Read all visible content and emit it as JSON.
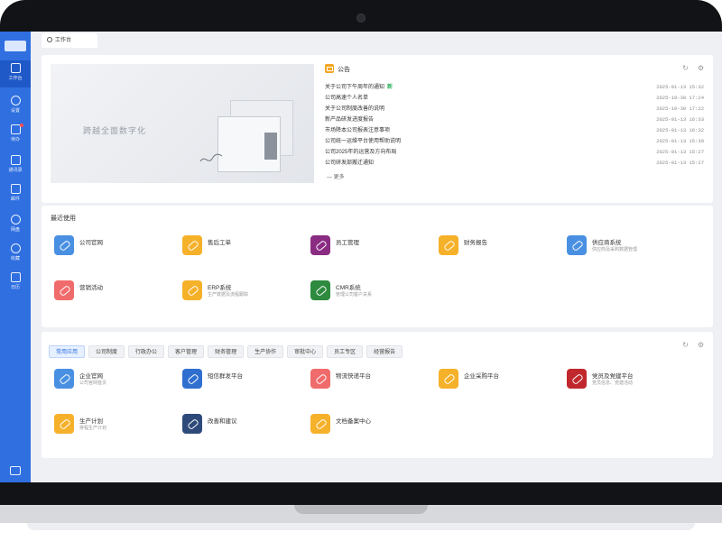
{
  "sidebar": {
    "items": [
      {
        "label": "工作台",
        "icon": "desktop-icon"
      },
      {
        "label": "设置",
        "icon": "settings-icon"
      },
      {
        "label": "待办",
        "icon": "todo-icon"
      },
      {
        "label": "通讯录",
        "icon": "contacts-icon"
      },
      {
        "label": "邮件",
        "icon": "mail-icon"
      },
      {
        "label": "网盘",
        "icon": "cloud-icon"
      },
      {
        "label": "收藏",
        "icon": "heart-icon"
      },
      {
        "label": "日历",
        "icon": "calendar-icon"
      }
    ]
  },
  "tab": {
    "label": "工作台"
  },
  "banner": {
    "text": "跨越全面数字化"
  },
  "notices": {
    "title": "公告",
    "more": "更多",
    "items": [
      {
        "title": "关于公司下午周年的通知",
        "date": "2025-01-13 15:32",
        "tag": "新"
      },
      {
        "title": "公司高速个人名单",
        "date": "2025-10-30 17:24",
        "tag": ""
      },
      {
        "title": "关于公司制度改善的说明",
        "date": "2025-10-30 17:22",
        "tag": ""
      },
      {
        "title": "新产品研发进度报告",
        "date": "2025-01-13 16:33",
        "tag": ""
      },
      {
        "title": "市场降本公司报表注意事项",
        "date": "2025-01-13 16:32",
        "tag": ""
      },
      {
        "title": "公司统一运维平台使用帮助说明",
        "date": "2025-01-13 15:30",
        "tag": ""
      },
      {
        "title": "公司2025年的运营及方向布局",
        "date": "2025-01-13 15:27",
        "tag": ""
      },
      {
        "title": "公司研发部搬迁通知",
        "date": "2025-01-13 15:27",
        "tag": ""
      }
    ]
  },
  "recent": {
    "title": "最近使用",
    "apps": [
      {
        "name": "公司官网",
        "desc": "",
        "color": "#4a90e2"
      },
      {
        "name": "售后工单",
        "desc": "",
        "color": "#f5b12a"
      },
      {
        "name": "员工管理",
        "desc": "",
        "color": "#8b2c83"
      },
      {
        "name": "财务报告",
        "desc": "",
        "color": "#f5b12a"
      },
      {
        "name": "供应商系统",
        "desc": "供应商及采购数据管理",
        "color": "#4a90e2"
      },
      {
        "name": "营销活动",
        "desc": "",
        "color": "#f06b6b"
      },
      {
        "name": "ERP系统",
        "desc": "生产数据及流程跟踪",
        "color": "#f5b12a"
      },
      {
        "name": "CMR系统",
        "desc": "管理公司客户关系",
        "color": "#2d8a3e"
      }
    ]
  },
  "apps_section": {
    "categories": [
      "常用应用",
      "公司制度",
      "行政办公",
      "客户管理",
      "财务管理",
      "生产协作",
      "审批中心",
      "员工专区",
      "经营报告"
    ],
    "apps": [
      {
        "name": "企业官网",
        "desc": "公司官网首页",
        "color": "#4a90e2"
      },
      {
        "name": "短信群发平台",
        "desc": "",
        "color": "#2f6fd0"
      },
      {
        "name": "物流快递平台",
        "desc": "",
        "color": "#f06b6b"
      },
      {
        "name": "企业采购平台",
        "desc": "",
        "color": "#f5b12a"
      },
      {
        "name": "党员及党建平台",
        "desc": "党员信息、党建活动",
        "color": "#c0282d"
      },
      {
        "name": "生产计划",
        "desc": "排程生产计划",
        "color": "#f5b12a"
      },
      {
        "name": "改善和建议",
        "desc": "",
        "color": "#2e4a7a"
      },
      {
        "name": "文档备案中心",
        "desc": "",
        "color": "#f5b12a"
      }
    ]
  },
  "colors": {
    "sidebar": "#2f6fe0",
    "accent": "#2f6fe0"
  }
}
